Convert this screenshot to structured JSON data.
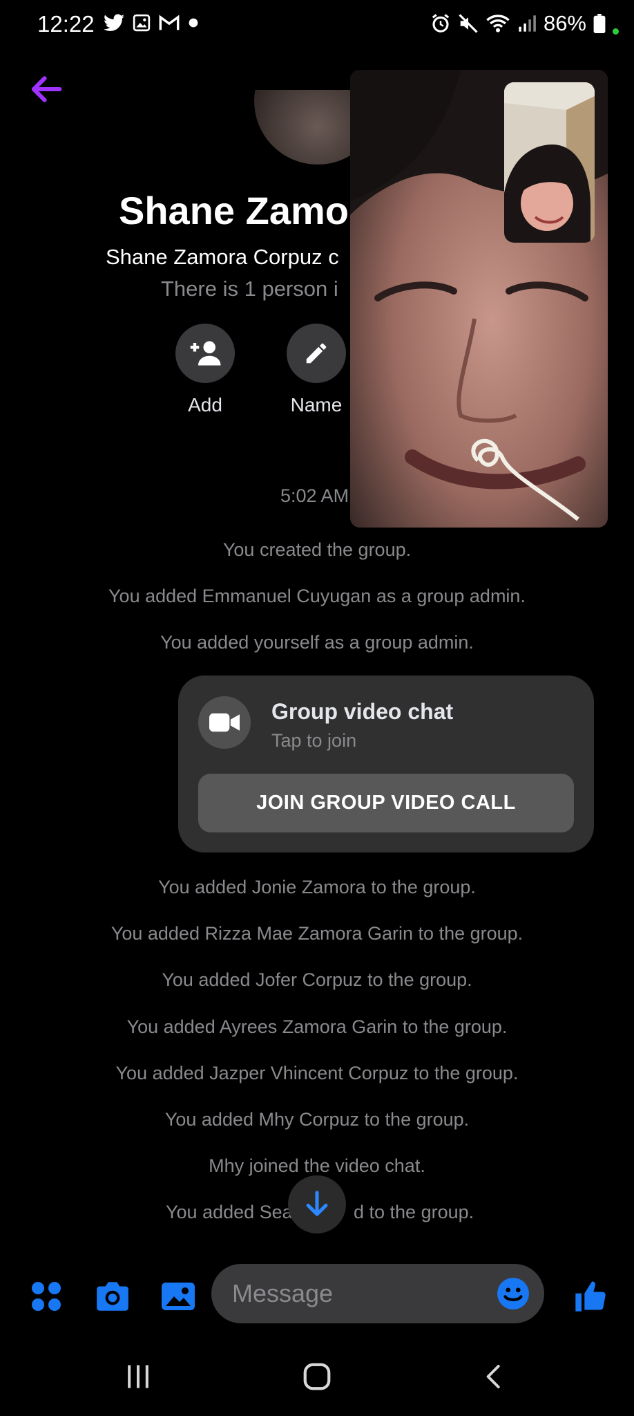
{
  "status_bar": {
    "time": "12:22",
    "battery": "86%",
    "left_icons": [
      "twitter-icon",
      "gallery-icon",
      "gmail-icon",
      "dot-icon"
    ],
    "right_icons": [
      "alarm-icon",
      "mute-icon",
      "wifi-icon",
      "signal-icon",
      "battery-icon"
    ]
  },
  "header": {
    "title": "Shane Zamor",
    "subtitle": "Shane Zamora Corpuz c",
    "member_count": "There is 1 person i",
    "actions": [
      {
        "label": "Add",
        "icon": "add-person-icon"
      },
      {
        "label": "Name",
        "icon": "pencil-icon"
      }
    ]
  },
  "conversation": {
    "timestamp": "5:02 AM",
    "events_before": [
      "You created the group.",
      "You added Emmanuel Cuyugan as a group admin.",
      "You added yourself as a group admin."
    ],
    "video_card": {
      "title": "Group video chat",
      "subtitle": "Tap to join",
      "join_label": "JOIN GROUP VIDEO CALL"
    },
    "events_after": [
      "You added Jonie Zamora to the group.",
      "You added Rizza Mae Zamora Garin to the group.",
      "You added Jofer Corpuz to the group.",
      "You added Ayrees Zamora Garin to the group.",
      "You added Jazper Vhincent Corpuz to the group.",
      "You added Mhy Corpuz to the group.",
      "Mhy joined the video chat.",
      "You added Sea",
      "d to the group."
    ]
  },
  "composer": {
    "placeholder": "Message",
    "icons": [
      "apps-icon",
      "camera-icon",
      "photo-icon",
      "emoji-icon",
      "like-icon"
    ]
  },
  "colors": {
    "accent": "#1877f2",
    "back_arrow": "#a033ff",
    "card_bg": "#303030",
    "muted_text": "#8a8a8e"
  }
}
